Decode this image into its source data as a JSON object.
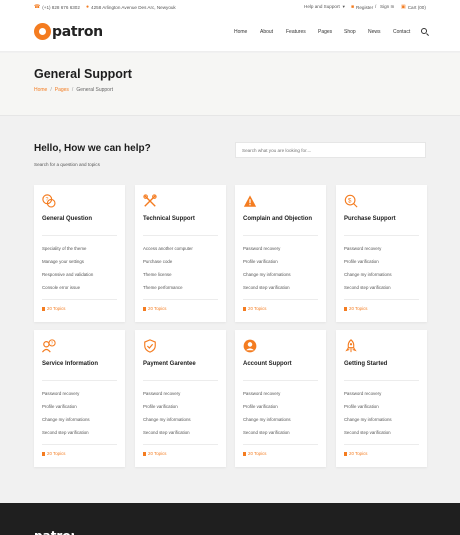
{
  "topbar": {
    "phone": "(+1) 828 676 6302",
    "address": "4258 Arlington Avenue Des Arc, Newyouk",
    "help": "Help and Support",
    "register": "Register",
    "signin": "Sign In",
    "slash": "/",
    "cart": "Cart (00)"
  },
  "nav": {
    "logo_text": "patron",
    "items": [
      "Home",
      "About",
      "Features",
      "Pages",
      "Shop",
      "News",
      "Contact"
    ]
  },
  "banner": {
    "title": "General Support",
    "crumbs": [
      "Home",
      "Pages",
      "General Support"
    ],
    "sep": "/"
  },
  "help": {
    "title": "Hello, How we can help?",
    "subtitle": "Search for a question and topics",
    "search_placeholder": "Search what you are looking for...."
  },
  "cards": [
    {
      "title": "General Question",
      "icon": "question-bubbles-icon",
      "items": [
        "Speciality of the theme",
        "Manage your settings",
        "Responsive and validation",
        "Console error issue"
      ],
      "footer": "20 Topics"
    },
    {
      "title": "Technical Support",
      "icon": "tools-icon",
      "items": [
        "Access another computer",
        "Purchase code",
        "Theme license",
        "Theme performance"
      ],
      "footer": "20 Topics"
    },
    {
      "title": "Complain and Objection",
      "icon": "warning-icon",
      "items": [
        "Password recovery",
        "Profile varification",
        "Change my informations",
        "Second step varification"
      ],
      "footer": "20 Topics"
    },
    {
      "title": "Purchase Support",
      "icon": "dollar-bubble-icon",
      "items": [
        "Password recovery",
        "Profile varification",
        "Change my informations",
        "Second step varification"
      ],
      "footer": "20 Topics"
    },
    {
      "title": "Service Information",
      "icon": "user-question-icon",
      "items": [
        "Password recovery",
        "Profile varification",
        "Change my informations",
        "Second step varification"
      ],
      "footer": "20 Topics"
    },
    {
      "title": "Payment Garentee",
      "icon": "shield-check-icon",
      "items": [
        "Password recovery",
        "Profile varification",
        "Change my informations",
        "Second step varification"
      ],
      "footer": "20 Topics"
    },
    {
      "title": "Account Support",
      "icon": "account-icon",
      "items": [
        "Password recovery",
        "Profile varification",
        "Change my informations",
        "Second step varification"
      ],
      "footer": "20 Topics"
    },
    {
      "title": "Getting Started",
      "icon": "rocket-icon",
      "items": [
        "Password recovery",
        "Profile varification",
        "Change my informations",
        "Second step varification"
      ],
      "footer": "20 Topics"
    }
  ],
  "footer": {
    "logo_text": "patron"
  },
  "colors": {
    "accent": "#f47c20",
    "footer_bg": "#1f1f1f",
    "page_bg": "#f1f1f1"
  }
}
